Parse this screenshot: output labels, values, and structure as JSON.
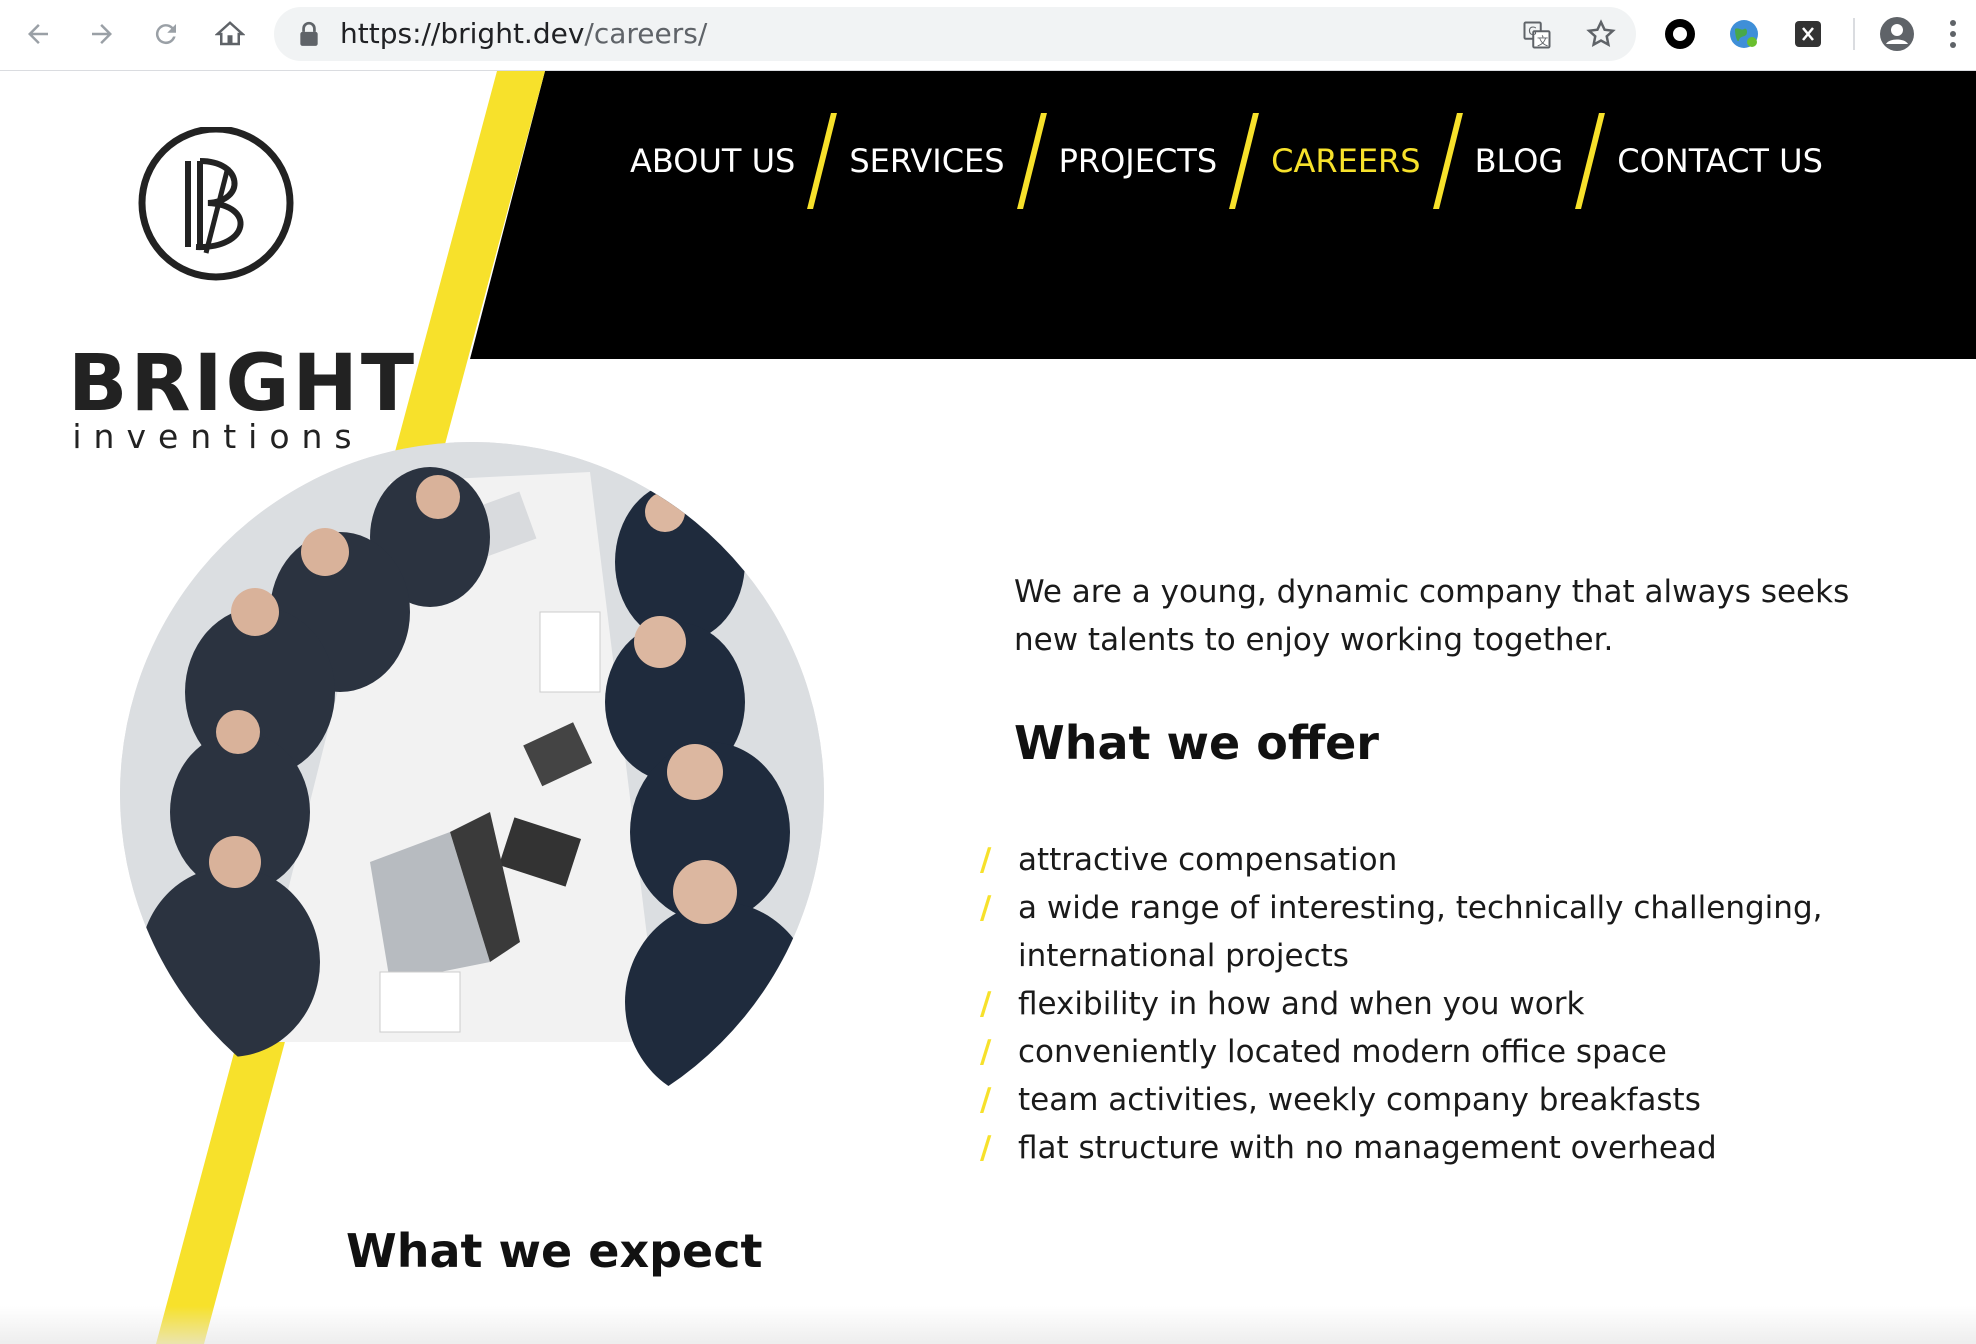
{
  "browser": {
    "url_host": "https://bright.dev",
    "url_path": "/careers/",
    "icons": [
      "back-arrow-icon",
      "forward-arrow-icon",
      "reload-icon",
      "home-icon",
      "lock-icon",
      "translate-icon",
      "star-icon",
      "circle-extension-icon",
      "globe-extension-icon",
      "x-extension-icon",
      "profile-icon",
      "menu-dots-icon"
    ]
  },
  "logo": {
    "word": "BRIGHT",
    "sub": "inventions",
    "monogram": "B"
  },
  "nav": {
    "items": [
      {
        "label": "ABOUT US"
      },
      {
        "label": "SERVICES"
      },
      {
        "label": "PROJECTS"
      },
      {
        "label": "CAREERS"
      },
      {
        "label": "BLOG"
      },
      {
        "label": "CONTACT US"
      }
    ],
    "active": "CAREERS"
  },
  "content": {
    "intro": "We are a young, dynamic company that always seeks new talents to enjoy working together.",
    "offer_heading": "What we offer",
    "offer_items": [
      "attractive compensation",
      "a wide range of interesting, technically challenging, international projects",
      "flexibility in how and when you work",
      "conveniently located modern office space",
      "team activities, weekly company breakfasts",
      "flat structure with no management overhead"
    ],
    "bullet": "/",
    "expect_heading": "What we expect"
  },
  "colors": {
    "accent": "#f7e12b",
    "header_bg": "#000000",
    "text": "#1a1a1a"
  }
}
